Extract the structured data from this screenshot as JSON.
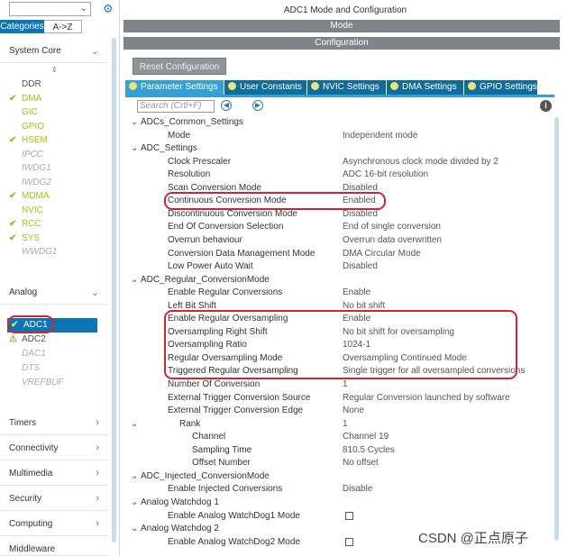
{
  "left_panel": {
    "search": {
      "value": "",
      "placeholder": ""
    },
    "tabs": {
      "categories": "Categories",
      "az": "A->Z"
    },
    "sections": {
      "system_core": "System Core",
      "analog": "Analog",
      "timers": "Timers",
      "connectivity": "Connectivity",
      "multimedia": "Multimedia",
      "security": "Security",
      "computing": "Computing",
      "middleware": "Middleware"
    },
    "system_core_items": [
      {
        "label": "DDR",
        "status": "none"
      },
      {
        "label": "DMA",
        "status": "check"
      },
      {
        "label": "GIC",
        "status": "none-lime"
      },
      {
        "label": "GPIO",
        "status": "none-lime"
      },
      {
        "label": "HSEM",
        "status": "check"
      },
      {
        "label": "IPCC",
        "status": "disabled"
      },
      {
        "label": "IWDG1",
        "status": "disabled"
      },
      {
        "label": "IWDG2",
        "status": "disabled"
      },
      {
        "label": "MDMA",
        "status": "check"
      },
      {
        "label": "NVIC",
        "status": "none-lime"
      },
      {
        "label": "RCC",
        "status": "check"
      },
      {
        "label": "SYS",
        "status": "check"
      },
      {
        "label": "WWDG1",
        "status": "disabled"
      }
    ],
    "analog_items": [
      {
        "label": "ADC1",
        "status": "selected-check"
      },
      {
        "label": "ADC2",
        "status": "warning"
      },
      {
        "label": "DAC1",
        "status": "disabled"
      },
      {
        "label": "DTS",
        "status": "disabled"
      },
      {
        "label": "VREFBUF",
        "status": "disabled"
      }
    ]
  },
  "right_panel": {
    "title": "ADC1 Mode and Configuration",
    "mode_band": "Mode",
    "config_band": "Configuration",
    "reset_button": "Reset Configuration",
    "tabs": [
      {
        "label": "Parameter Settings",
        "active": true
      },
      {
        "label": "User Constants",
        "active": false
      },
      {
        "label": "NVIC Settings",
        "active": false
      },
      {
        "label": "DMA Settings",
        "active": false
      },
      {
        "label": "GPIO Settings",
        "active": false
      }
    ],
    "param_search": {
      "value": "",
      "placeholder": "Search (Crtl+F)"
    },
    "rows": [
      {
        "type": "group",
        "key": "ADCs_Common_Settings",
        "value": ""
      },
      {
        "type": "param",
        "key": "Mode",
        "value": "Independent mode"
      },
      {
        "type": "group",
        "key": "ADC_Settings",
        "value": ""
      },
      {
        "type": "param",
        "key": "Clock Prescaler",
        "value": "Asynchronous clock mode divided by 2"
      },
      {
        "type": "param",
        "key": "Resolution",
        "value": "ADC 16-bit resolution"
      },
      {
        "type": "param",
        "key": "Scan Conversion Mode",
        "value": "Disabled"
      },
      {
        "type": "param",
        "key": "Continuous Conversion Mode",
        "value": "Enabled"
      },
      {
        "type": "param",
        "key": "Discontinuous Conversion Mode",
        "value": "Disabled"
      },
      {
        "type": "param",
        "key": "End Of Conversion Selection",
        "value": "End of single conversion"
      },
      {
        "type": "param",
        "key": "Overrun behaviour",
        "value": "Overrun data overwritten"
      },
      {
        "type": "param",
        "key": "Conversion Data Management Mode",
        "value": "DMA Circular Mode"
      },
      {
        "type": "param",
        "key": "Low Power Auto Wait",
        "value": "Disabled"
      },
      {
        "type": "group",
        "key": "ADC_Regular_ConversionMode",
        "value": ""
      },
      {
        "type": "param",
        "key": "Enable Regular Conversions",
        "value": "Enable"
      },
      {
        "type": "param",
        "key": "Left Bit Shift",
        "value": "No bit shift"
      },
      {
        "type": "param",
        "key": "Enable Regular Oversampling",
        "value": "Enable"
      },
      {
        "type": "param",
        "key": "Oversampling Right Shift",
        "value": "No bit shift for oversampling"
      },
      {
        "type": "param",
        "key": "Oversampling Ratio",
        "value": "1024-1"
      },
      {
        "type": "param",
        "key": "Regular Oversampling Mode",
        "value": "Oversampling Continued Mode"
      },
      {
        "type": "param",
        "key": "Triggered Regular Oversampling",
        "value": "Single trigger for all oversampled conversions"
      },
      {
        "type": "param",
        "key": "Number Of Conversion",
        "value": "1"
      },
      {
        "type": "param",
        "key": "External Trigger Conversion Source",
        "value": "Regular Conversion launched by software"
      },
      {
        "type": "param",
        "key": "External Trigger Conversion Edge",
        "value": "None"
      },
      {
        "type": "subgroup",
        "key": "Rank",
        "value": "1"
      },
      {
        "type": "sub",
        "key": "Channel",
        "value": "Channel 19"
      },
      {
        "type": "sub",
        "key": "Sampling Time",
        "value": "810.5 Cycles"
      },
      {
        "type": "sub",
        "key": "Offset Number",
        "value": "No offset"
      },
      {
        "type": "group",
        "key": "ADC_Injected_ConversionMode",
        "value": ""
      },
      {
        "type": "param",
        "key": "Enable Injected Conversions",
        "value": "Disable"
      },
      {
        "type": "group",
        "key": "Analog Watchdog 1",
        "value": ""
      },
      {
        "type": "check",
        "key": "Enable Analog WatchDog1 Mode",
        "value": ""
      },
      {
        "type": "group",
        "key": "Analog Watchdog 2",
        "value": ""
      },
      {
        "type": "check",
        "key": "Enable Analog WatchDog2 Mode",
        "value": ""
      }
    ]
  },
  "watermark": "CSDN @正点原子",
  "colors": {
    "accent": "#0b75b8",
    "tab_active": "#37a0d2",
    "highlight_ring": "#d62232",
    "ok_check": "#8fbf2a",
    "band_gray": "#7e8487"
  }
}
